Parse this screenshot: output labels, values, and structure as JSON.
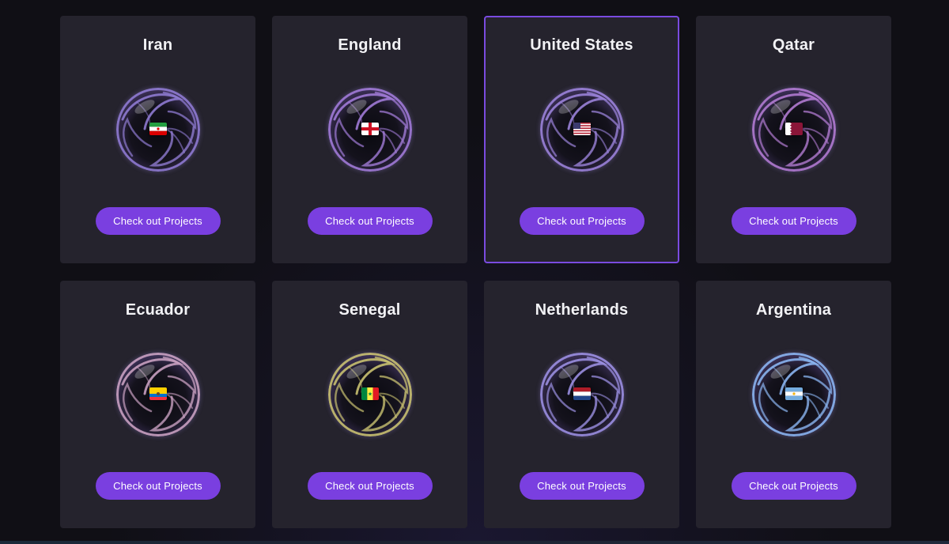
{
  "cards": [
    {
      "country": "Iran",
      "flag": "iran-flag-icon",
      "button_label": "Check out Projects",
      "ball_tint": "#8e7ad0",
      "selected": false
    },
    {
      "country": "England",
      "flag": "england-flag-icon",
      "button_label": "Check out Projects",
      "ball_tint": "#a07ad6",
      "selected": false
    },
    {
      "country": "United States",
      "flag": "usa-flag-icon",
      "button_label": "Check out Projects",
      "ball_tint": "#9a82d8",
      "selected": true
    },
    {
      "country": "Qatar",
      "flag": "qatar-flag-icon",
      "button_label": "Check out Projects",
      "ball_tint": "#b07ad0",
      "selected": false
    },
    {
      "country": "Ecuador",
      "flag": "ecuador-flag-icon",
      "button_label": "Check out Projects",
      "ball_tint": "#c8a0c0",
      "selected": false
    },
    {
      "country": "Senegal",
      "flag": "senegal-flag-icon",
      "button_label": "Check out Projects",
      "ball_tint": "#c8c070",
      "selected": false
    },
    {
      "country": "Netherlands",
      "flag": "netherlands-flag-icon",
      "button_label": "Check out Projects",
      "ball_tint": "#9a8ee0",
      "selected": false
    },
    {
      "country": "Argentina",
      "flag": "argentina-flag-icon",
      "button_label": "Check out Projects",
      "ball_tint": "#8ab4f0",
      "selected": false
    }
  ],
  "colors": {
    "accent": "#7a3fe0",
    "card_bg": "#25232d",
    "selected_border": "#7a4be0",
    "page_bg": "#100f15"
  }
}
